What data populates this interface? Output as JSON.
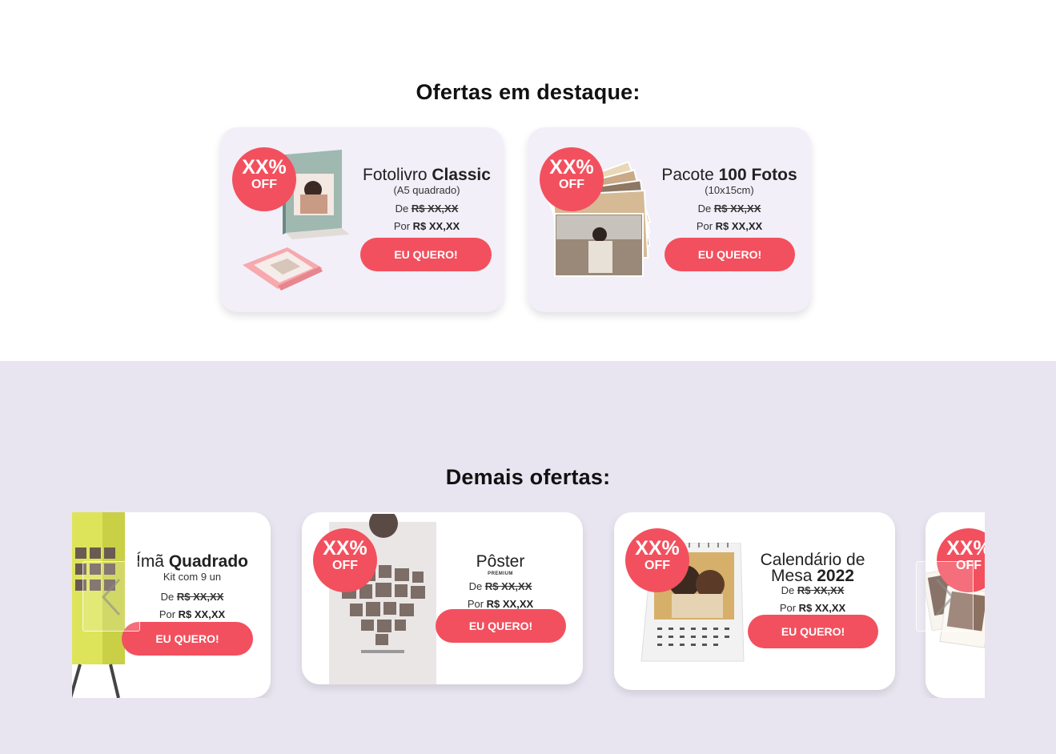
{
  "featured": {
    "title": "Ofertas em destaque:",
    "cards": [
      {
        "badge": {
          "pct": "XX%",
          "off": "OFF"
        },
        "name_regular": "Fotolivro ",
        "name_bold": "Classic",
        "subtitle": "(A5 quadrado)",
        "from_label": "De ",
        "from_price": "R$ XX,XX",
        "now_label": "Por ",
        "now_price": "R$ XX,XX",
        "cta": "EU QUERO!",
        "image_icon": "photobook-image"
      },
      {
        "badge": {
          "pct": "XX%",
          "off": "OFF"
        },
        "name_regular": "Pacote ",
        "name_bold": "100 Fotos",
        "subtitle": "(10x15cm)",
        "from_label": "De ",
        "from_price": "R$ XX,XX",
        "now_label": "Por ",
        "now_price": "R$ XX,XX",
        "cta": "EU QUERO!",
        "image_icon": "photo-stack-image"
      }
    ]
  },
  "others": {
    "title": "Demais ofertas:",
    "cards": [
      {
        "name_regular": "Ímã ",
        "name_bold": "Quadrado",
        "subtitle": "Kit com 9 un",
        "from_label": "De ",
        "from_price": "R$ XX,XX",
        "now_label": "Por ",
        "now_price": "R$ XX,XX",
        "cta": "EU QUERO!",
        "image_icon": "fridge-magnets-image"
      },
      {
        "badge": {
          "pct": "XX%",
          "off": "OFF"
        },
        "name_regular": "Pôster",
        "name_bold": "",
        "subtitle": "PREMIUM",
        "from_label": "De ",
        "from_price": "R$ XX,XX",
        "now_label": "Por ",
        "now_price": "R$ XX,XX",
        "cta": "EU QUERO!",
        "image_icon": "poster-image"
      },
      {
        "badge": {
          "pct": "XX%",
          "off": "OFF"
        },
        "name_line1": "Calendário de",
        "name_regular": "Mesa ",
        "name_bold": "2022",
        "from_label": "De ",
        "from_price": "R$ XX,XX",
        "now_label": "Por ",
        "now_price": "R$ XX,XX",
        "cta": "EU QUERO!",
        "image_icon": "desk-calendar-image"
      },
      {
        "badge": {
          "pct": "XX%",
          "off": "OFF"
        },
        "image_icon": "polaroid-prints-image"
      }
    ],
    "prev_icon": "chevron-left-icon",
    "next_icon": "chevron-right-icon"
  },
  "colors": {
    "accent": "#f2505e",
    "featured_card_bg": "#f2eff8",
    "section_bg": "#e8e5f0"
  }
}
